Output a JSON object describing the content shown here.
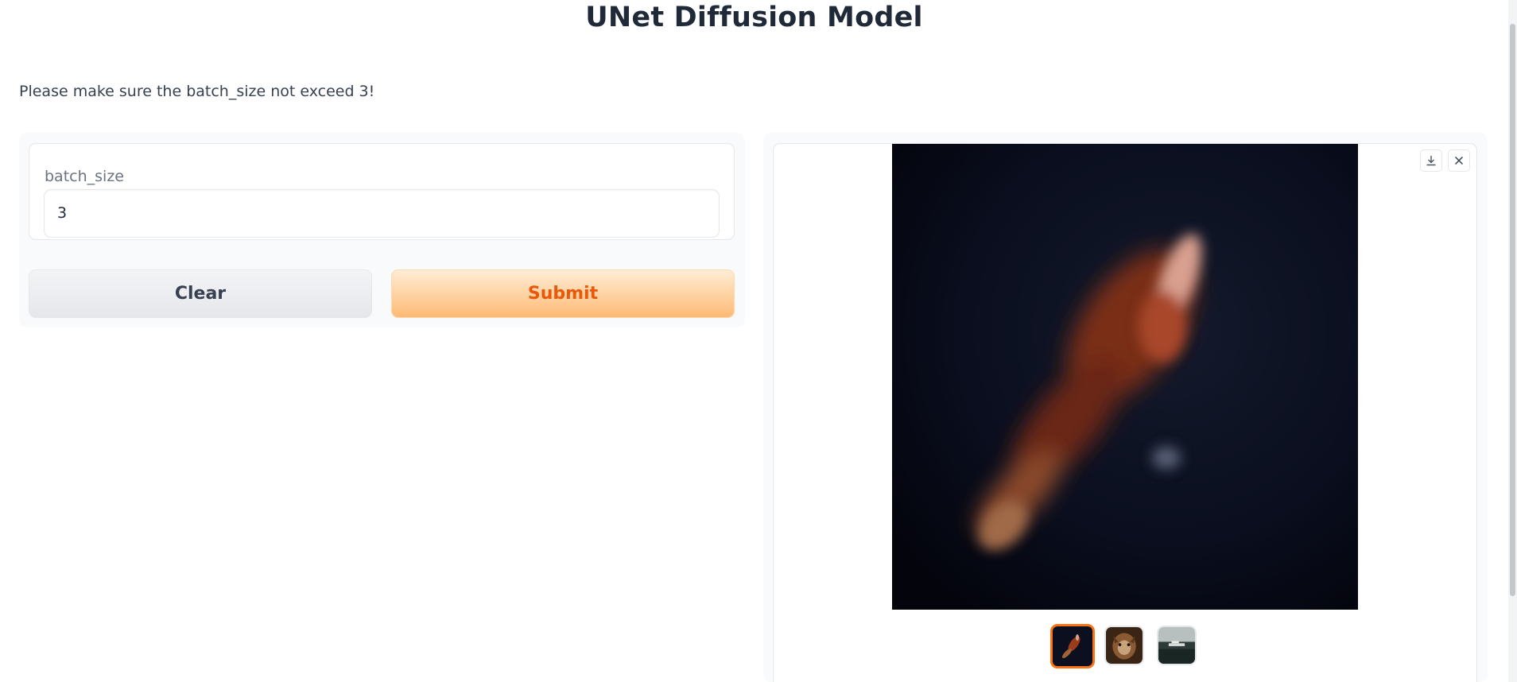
{
  "header": {
    "title": "UNet Diffusion Model",
    "notice": "Please make sure the batch_size not exceed 3!"
  },
  "form": {
    "batch_size_label": "batch_size",
    "batch_size_value": "3",
    "clear_label": "Clear",
    "submit_label": "Submit"
  },
  "gallery": {
    "selected_index": 0,
    "thumbnails": [
      "bird",
      "fox",
      "boat"
    ]
  },
  "colors": {
    "accent": "#f97316",
    "submit_text": "#ea580c"
  }
}
